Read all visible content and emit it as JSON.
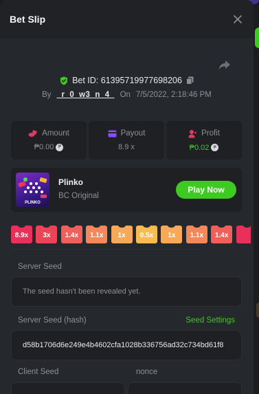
{
  "header": {
    "title": "Bet Slip"
  },
  "bet": {
    "id_label": "Bet ID: 61395719977698206",
    "by_label": "By",
    "user": "_r_0_w3_n_4_",
    "on_label": "On",
    "datetime": "7/5/2022, 2:18:46 PM"
  },
  "stats": {
    "amount": {
      "label": "Amount",
      "value": "₱0.00"
    },
    "payout": {
      "label": "Payout",
      "value": "8.9 x"
    },
    "profit": {
      "label": "Profit",
      "value": "₱0.02"
    }
  },
  "game": {
    "name": "Plinko",
    "subtitle": "BC Original",
    "play_label": "Play Now",
    "thumb_text": "PLINKO"
  },
  "multipliers": [
    {
      "label": "8.9x",
      "color": "#e8305a"
    },
    {
      "label": "3x",
      "color": "#eb4456"
    },
    {
      "label": "1.4x",
      "color": "#f0605a"
    },
    {
      "label": "1.1x",
      "color": "#f4885a"
    },
    {
      "label": "1x",
      "color": "#f6a958"
    },
    {
      "label": "0.5x",
      "color": "#f8bb52"
    },
    {
      "label": "1x",
      "color": "#f6a958"
    },
    {
      "label": "1.1x",
      "color": "#f4885a"
    },
    {
      "label": "1.4x",
      "color": "#f0605a"
    },
    {
      "label": "",
      "color": "#e8305a"
    }
  ],
  "seeds": {
    "server_seed_label": "Server Seed",
    "server_seed_value": "The seed hasn't been revealed yet.",
    "server_hash_label": "Server Seed (hash)",
    "seed_settings_label": "Seed Settings",
    "server_hash_value": "d58b1706d6e249e4b4602cfa1028b336756ad32c734bd61f8",
    "client_seed_label": "Client Seed",
    "nonce_label": "nonce"
  },
  "colors": {
    "accent_green": "#3ecb21",
    "bg_panel": "#25282c",
    "bg_card": "#1e2024"
  },
  "icons": [
    "close-icon",
    "share-icon",
    "shield-check-icon",
    "copy-icon",
    "coins-icon",
    "payout-icon",
    "profit-icon",
    "coin-icon"
  ]
}
